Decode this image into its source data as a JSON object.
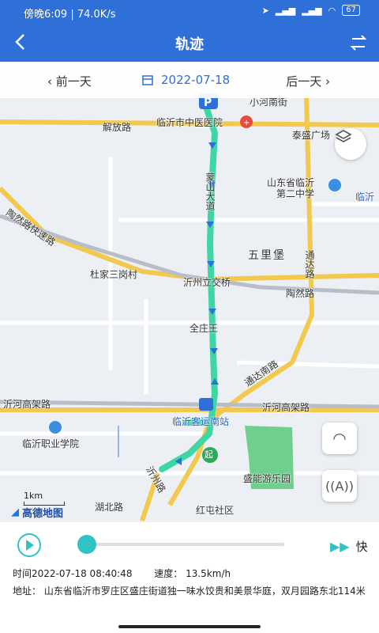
{
  "status": {
    "time": "傍晚6:09",
    "speed": "74.0K/s",
    "battery": "67"
  },
  "header": {
    "title": "轨迹"
  },
  "datebar": {
    "prev": "前一天",
    "date": "2022-07-18",
    "next": "后一天"
  },
  "map": {
    "labels": {
      "jiefang_lu": "解放路",
      "hospital": "临沂市中医医院",
      "taisheng": "泰盛广场",
      "school": "山东省临沂",
      "school2": "第二中学",
      "linyi_r": "临沂",
      "taoran_express": "陶然路快速路",
      "wulipu": "五里堡",
      "tongda": "通达路",
      "dujia": "杜家三岗村",
      "yizhou_bridge": "沂州立交桥",
      "taoran_lu": "陶然路",
      "quanzhuang": "全庄王",
      "tongda_south": "通达南路",
      "yihe_left": "沂河高架路",
      "yihe_right": "沂河高架路",
      "station": "临沂客运南站",
      "vocational": "临沂职业学院",
      "shengneng": "盛能游乐园",
      "hubei": "湖北路",
      "hongtun": "红屯社区",
      "lanhe": "小河南街",
      "street_v": "蒙山大道",
      "yizhou_south": "沂州路",
      "start_tag": "起"
    },
    "scale": "1km",
    "brand": "高德地图"
  },
  "controls": {
    "speed_label": "快"
  },
  "info": {
    "time": "时间2022-07-18 08:40:48",
    "speed": "速度：  13.5km/h",
    "address": "地址：  山东省临沂市罗庄区盛庄街道独一味水饺贵和美景华庭，双月园路东北114米"
  },
  "colors": {
    "primary": "#2f6fd8",
    "track": "#3ed6a4",
    "accent": "#2fc3c3"
  }
}
